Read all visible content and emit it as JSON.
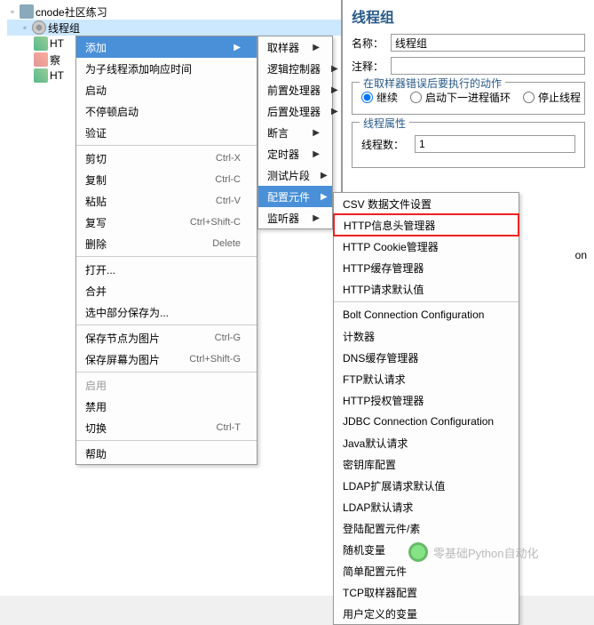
{
  "tree": {
    "root": "cnode社区练习",
    "thread_group": "线程组",
    "http1": "HT",
    "view": "察",
    "http2": "HT"
  },
  "right": {
    "title": "线程组",
    "name_label": "名称：",
    "name_value": "线程组",
    "comment_label": "注释：",
    "comment_value": "",
    "error_legend": "在取样器错误后要执行的动作",
    "radio_continue": "继续",
    "radio_next": "启动下一进程循环",
    "radio_stop": "停止线程",
    "thread_props_legend": "线程属性",
    "thread_count_label": "线程数：",
    "thread_count_value": "1",
    "on_suffix": "on"
  },
  "menu1": [
    {
      "label": "添加",
      "arrow": true,
      "hi": true
    },
    {
      "label": "为子线程添加响应时间"
    },
    {
      "label": "启动"
    },
    {
      "label": "不停顿启动"
    },
    {
      "label": "验证"
    },
    {
      "sep": true
    },
    {
      "label": "剪切",
      "shortcut": "Ctrl-X"
    },
    {
      "label": "复制",
      "shortcut": "Ctrl-C"
    },
    {
      "label": "粘贴",
      "shortcut": "Ctrl-V"
    },
    {
      "label": "复写",
      "shortcut": "Ctrl+Shift-C"
    },
    {
      "label": "删除",
      "shortcut": "Delete"
    },
    {
      "sep": true
    },
    {
      "label": "打开..."
    },
    {
      "label": "合并"
    },
    {
      "label": "选中部分保存为..."
    },
    {
      "sep": true
    },
    {
      "label": "保存节点为图片",
      "shortcut": "Ctrl-G"
    },
    {
      "label": "保存屏幕为图片",
      "shortcut": "Ctrl+Shift-G"
    },
    {
      "sep": true
    },
    {
      "label": "启用",
      "disabled": true
    },
    {
      "label": "禁用"
    },
    {
      "label": "切换",
      "shortcut": "Ctrl-T"
    },
    {
      "sep": true
    },
    {
      "label": "帮助"
    }
  ],
  "menu2": [
    {
      "label": "取样器",
      "arrow": true
    },
    {
      "label": "逻辑控制器",
      "arrow": true
    },
    {
      "label": "前置处理器",
      "arrow": true
    },
    {
      "label": "后置处理器",
      "arrow": true
    },
    {
      "label": "断言",
      "arrow": true
    },
    {
      "label": "定时器",
      "arrow": true
    },
    {
      "label": "测试片段",
      "arrow": true
    },
    {
      "label": "配置元件",
      "arrow": true,
      "hi": true
    },
    {
      "label": "监听器",
      "arrow": true
    }
  ],
  "menu3": [
    {
      "label": "CSV 数据文件设置"
    },
    {
      "label": "HTTP信息头管理器",
      "boxed": true
    },
    {
      "label": "HTTP Cookie管理器"
    },
    {
      "label": "HTTP缓存管理器"
    },
    {
      "label": "HTTP请求默认值"
    },
    {
      "sep": true
    },
    {
      "label": "Bolt Connection Configuration"
    },
    {
      "label": "计数器"
    },
    {
      "label": "DNS缓存管理器"
    },
    {
      "label": "FTP默认请求"
    },
    {
      "label": "HTTP授权管理器"
    },
    {
      "label": "JDBC Connection Configuration"
    },
    {
      "label": "Java默认请求"
    },
    {
      "label": "密钥库配置"
    },
    {
      "label": "LDAP扩展请求默认值"
    },
    {
      "label": "LDAP默认请求"
    },
    {
      "label": "登陆配置元件/素"
    },
    {
      "label": "随机变量"
    },
    {
      "label": "简单配置元件"
    },
    {
      "label": "TCP取样器配置"
    },
    {
      "label": "用户定义的变量"
    }
  ],
  "watermark": "零基础Python自动化"
}
